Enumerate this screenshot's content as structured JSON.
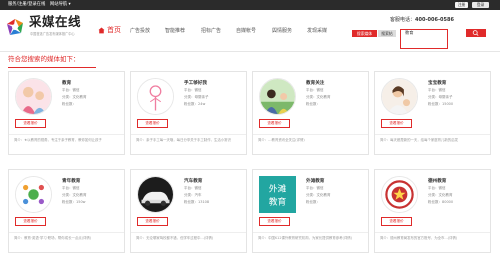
{
  "topbar": {
    "left_text": "服务/注册/登录在线",
    "menu_text": "网站导航 ▾",
    "login_label": "注册",
    "register_label": "登录"
  },
  "logo": {
    "title": "采媒在线",
    "subtitle": "中国首选广告发布媒体推广中心"
  },
  "hotline": {
    "label": "客服电话：",
    "number": "400-006-0586"
  },
  "nav": [
    {
      "label": "首页"
    },
    {
      "label": "广告投放"
    },
    {
      "label": "智能推荐"
    },
    {
      "label": "招标广告"
    },
    {
      "label": "自媒帐号"
    },
    {
      "label": "舆情服务"
    },
    {
      "label": "发现采媒"
    }
  ],
  "search": {
    "tab_active": "搜索媒体",
    "tab_other": "搜索帖",
    "value": "教育"
  },
  "section": {
    "title": "符合您搜索的媒体如下："
  },
  "cards": [
    {
      "name": "教育",
      "platform": "平台：微信",
      "category": "分类：文化教育",
      "fans": "粉丝数：",
      "button": "查看报价",
      "desc": "简介：★以教育的视角，专注于亲子教育，教你如何让孩子"
    },
    {
      "name": "手工够好我",
      "platform": "平台：微信",
      "category": "分类：母婴亲子",
      "fans": "粉丝数：24w",
      "button": "查看报价",
      "desc": "简介：亲子手工每一天哦，每日分享关于手工制作，生活小常识"
    },
    {
      "name": "教育关注",
      "platform": "平台：微信",
      "category": "分类：文化教育",
      "fans": "粉丝数：",
      "button": "查看报价",
      "desc": "简介：…教育资讯全关注(详情)"
    },
    {
      "name": "宝宝教育",
      "platform": "平台：微信",
      "category": "分类：母婴亲子",
      "fans": "粉丝数：15000",
      "button": "查看报价",
      "desc": "简介：每天都是新的一天，给每个家庭育儿新的启发"
    },
    {
      "name": "青年教育",
      "platform": "平台：微信",
      "category": "分类：文化教育",
      "fans": "粉丝数：150w",
      "button": "查看报价",
      "desc": "简介：教育·英语·学习·职场，帮你成长一点点(详情)"
    },
    {
      "name": "汽车教育",
      "platform": "平台：微信",
      "category": "分类：汽车",
      "fans": "粉丝数：13108",
      "button": "查看报价",
      "desc": "简介：无论哪家驾校都不错，但学车过程中…(详情)"
    },
    {
      "name": "外滩教育",
      "platform": "平台：微信",
      "category": "分类：文化教育",
      "fans": "粉丝数：",
      "button": "查看报价",
      "desc": "简介：中国K12课外教育研究机构，为家长提供教育参考(详情)"
    },
    {
      "name": "德州教育",
      "platform": "平台：微信",
      "category": "分类：文化教育",
      "fans": "粉丝数：80000",
      "button": "查看报价",
      "desc": "简介：德州教育局发布的官方账号，为全市…(详情)"
    }
  ],
  "icons": {
    "logo": "logo-swirl-icon",
    "home": "home-icon",
    "search": "search-icon"
  },
  "colors": {
    "accent": "#e02a2a",
    "topbar": "#2b2b2b",
    "card_border": "#e4e4e4"
  }
}
